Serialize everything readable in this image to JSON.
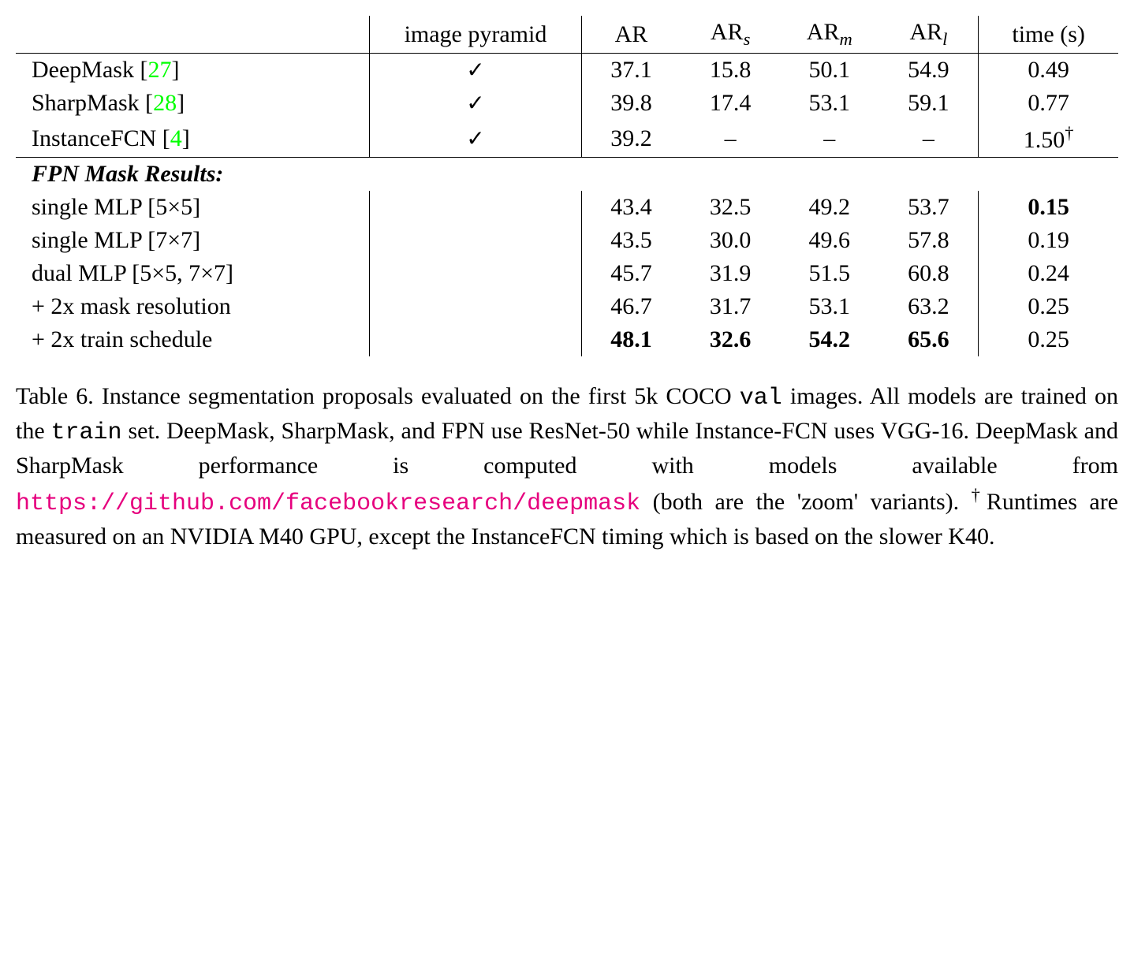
{
  "chart_data": {
    "type": "table",
    "headers": {
      "method": "",
      "pyramid": "image pyramid",
      "ar": "AR",
      "ars": "AR",
      "ars_sub": "s",
      "arm": "AR",
      "arm_sub": "m",
      "arl": "AR",
      "arl_sub": "l",
      "time": "time (s)"
    },
    "rows_top": [
      {
        "method": "DeepMask [",
        "cite": "27",
        "method_end": "]",
        "pyramid": "✓",
        "ar": "37.1",
        "ars": "15.8",
        "arm": "50.1",
        "arl": "54.9",
        "time": "0.49",
        "dagger": ""
      },
      {
        "method": "SharpMask [",
        "cite": "28",
        "method_end": "]",
        "pyramid": "✓",
        "ar": "39.8",
        "ars": "17.4",
        "arm": "53.1",
        "arl": "59.1",
        "time": "0.77",
        "dagger": ""
      },
      {
        "method": "InstanceFCN [",
        "cite": "4",
        "method_end": "]",
        "pyramid": "✓",
        "ar": "39.2",
        "ars": "–",
        "arm": "–",
        "arl": "–",
        "time": "1.50",
        "dagger": "†"
      }
    ],
    "section_header": "FPN Mask Results:",
    "rows_bottom": [
      {
        "method": "single MLP [5×5]",
        "pyramid": "",
        "ar": "43.4",
        "ars": "32.5",
        "arm": "49.2",
        "arl": "53.7",
        "time": "0.15",
        "bold_time": true
      },
      {
        "method": "single MLP [7×7]",
        "pyramid": "",
        "ar": "43.5",
        "ars": "30.0",
        "arm": "49.6",
        "arl": "57.8",
        "time": "0.19"
      },
      {
        "method": "dual MLP [5×5, 7×7]",
        "pyramid": "",
        "ar": "45.7",
        "ars": "31.9",
        "arm": "51.5",
        "arl": "60.8",
        "time": "0.24"
      },
      {
        "method": "+ 2x mask resolution",
        "pyramid": "",
        "ar": "46.7",
        "ars": "31.7",
        "arm": "53.1",
        "arl": "63.2",
        "time": "0.25"
      },
      {
        "method": "+ 2x train schedule",
        "pyramid": "",
        "ar": "48.1",
        "ars": "32.6",
        "arm": "54.2",
        "arl": "65.6",
        "time": "0.25",
        "bold_row": true
      }
    ]
  },
  "caption": {
    "prefix": "Table 6. Instance segmentation proposals evaluated on the first 5k COCO ",
    "val": "val",
    "text2": " images.  All models are trained on the ",
    "train": "train",
    "text3": " set. DeepMask, SharpMask, and FPN use ResNet-50 while Instance-FCN uses VGG-16.  DeepMask and SharpMask performance is computed with models available from ",
    "link": "https://github.com/facebookresearch/deepmask",
    "text4": " (both are the 'zoom' variants). ",
    "dagger": "†",
    "text5": "Runtimes are measured on an NVIDIA M40 GPU, except the InstanceFCN timing which is based on the slower K40."
  }
}
